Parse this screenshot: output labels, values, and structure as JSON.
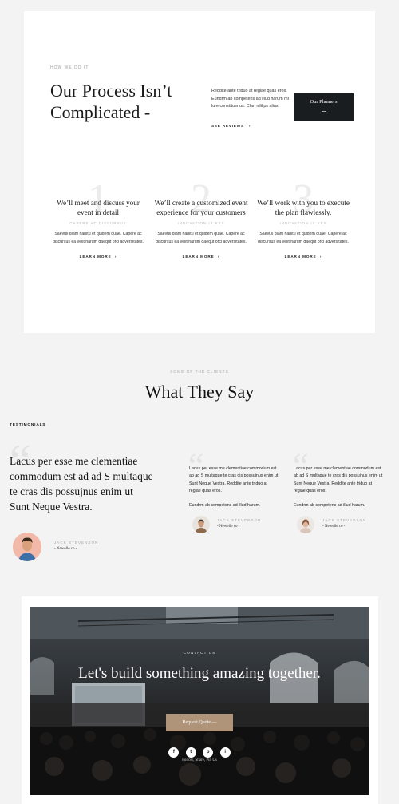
{
  "process": {
    "eyebrow": "HOW WE DO IT",
    "title": "Our Process Isn’t Complicated -",
    "text": "Reddite ante triduo at regiae quas eros. Eundrm ab competens ad illud harum mi lure constituenus. Clari nililips alias.",
    "see_reviews": "SEE REVIEWS",
    "planners_button": "Our Planners",
    "steps": [
      {
        "number": "1",
        "title": "We’ll meet and discuss your event in detail",
        "subtitle": "CAPERE AC DISCURSUS",
        "text": "Saevull diam habitu et quidem quae. Capere ac discursus ea velit harum daequt orci adversitates.",
        "link": "LEARN MORE"
      },
      {
        "number": "2",
        "title": "We’ll create a customized event experience for your customers",
        "subtitle": "INNOVATION IS KEY",
        "text": "Saevull diam habitu et quidem quae. Capere ac discursus ea velit harum daequt orci adversitates.",
        "link": "LEARN MORE"
      },
      {
        "number": "3",
        "title": "We’ll work with you to execute the plan flawlessly.",
        "subtitle": "INNOVATION IS KEY",
        "text": "Saevull diam habitu et quidem quae. Capere ac discursus ea velit harum daequt orci adversitates.",
        "link": "LEARN MORE"
      }
    ]
  },
  "testimonials": {
    "eyebrow": "SOME OF THE CLIENTS",
    "title": "What They Say",
    "label": "TESTIMONIALS",
    "featured": {
      "quote": "Lacus per esse me clementiae commodum est ad ad S multaque te cras dis possujnus enim ut Sunt Neque Vestra.",
      "name": "JACK STEVENSON",
      "company": "- Newelle co -"
    },
    "items": [
      {
        "p1": "Lacus per esse me clementiae commodum est ab ad S multaque te cras dis possujnus enim ut Sunt Neque Vestra. Reddite ante triduo at regiae quas eros.",
        "p2": "Eundrm ab competens ad illud harum.",
        "name": "JACK STEVENSON",
        "company": "- Newelle co -"
      },
      {
        "p1": "Lacus per esse me clementiae commodum est ab ad S multaque te cras dis possujnus enim ut Sunt Neque Vestra. Reddite ante triduo at regiae quas eros.",
        "p2": "Eundrm ab competens ad illud harum.",
        "name": "JACK STEVENSON",
        "company": "- Newelle co -"
      }
    ]
  },
  "cta": {
    "eyebrow": "CONTACT US",
    "title": "Let's build something amazing together.",
    "button": "Request Quote  —",
    "socials": [
      "f",
      "t",
      "p",
      "i"
    ],
    "follow": "Follow, Share, Pin Us"
  },
  "colors": {
    "dark_button": "#1a1d20",
    "accent": "#b09479"
  }
}
